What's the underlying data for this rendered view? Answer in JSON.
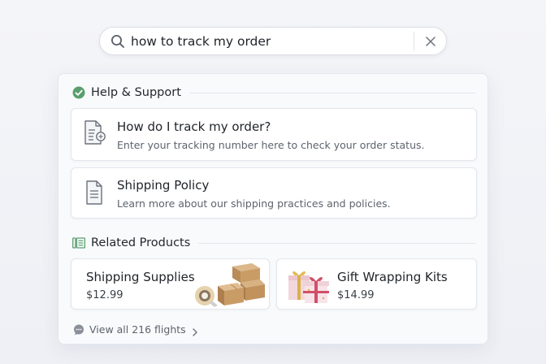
{
  "search": {
    "value": "how to track my order",
    "placeholder": "Search"
  },
  "help_section": {
    "title": "Help & Support",
    "items": [
      {
        "title": "How do I track my order?",
        "description": "Enter your tracking number here to check your order status."
      },
      {
        "title": "Shipping Policy",
        "description": "Learn more about our shipping practices and policies."
      }
    ]
  },
  "products_section": {
    "title": "Related Products",
    "items": [
      {
        "name": "Shipping Supplies",
        "price": "$12.99"
      },
      {
        "name": "Gift Wrapping Kits",
        "price": "$14.99"
      }
    ]
  },
  "footer": {
    "view_all": "View all 216 flights"
  },
  "colors": {
    "accent_green": "#5a9e6f",
    "icon_gray": "#6b717b"
  }
}
